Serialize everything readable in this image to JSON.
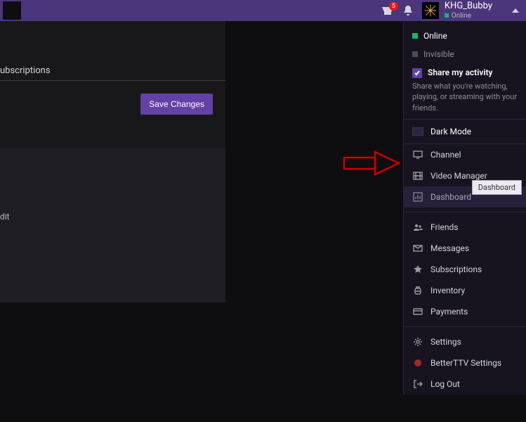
{
  "topbar": {
    "notification_count": "5",
    "username": "KHG_Bubby",
    "status_label": "Online"
  },
  "content": {
    "section_title": "ubscriptions",
    "save_button_label": "Save Changes",
    "partial_text": "dit"
  },
  "dropdown": {
    "status": {
      "online": "Online",
      "invisible": "Invisible"
    },
    "share": {
      "label": "Share my activity",
      "description": "Share what you're watching, playing, or streaming with your friends."
    },
    "dark_mode_label": "Dark Mode",
    "items_group1": [
      {
        "label": "Channel",
        "icon": "monitor-icon"
      },
      {
        "label": "Video Manager",
        "icon": "film-icon"
      },
      {
        "label": "Dashboard",
        "icon": "chart-icon",
        "highlight": true
      }
    ],
    "items_group2": [
      {
        "label": "Friends",
        "icon": "friends-icon"
      },
      {
        "label": "Messages",
        "icon": "mail-icon"
      },
      {
        "label": "Subscriptions",
        "icon": "star-icon"
      },
      {
        "label": "Inventory",
        "icon": "backpack-icon"
      },
      {
        "label": "Payments",
        "icon": "card-icon"
      }
    ],
    "items_group3": [
      {
        "label": "Settings",
        "icon": "gear-icon"
      },
      {
        "label": "BetterTTV Settings",
        "icon": "bttv-icon"
      },
      {
        "label": "Log Out",
        "icon": "logout-icon"
      }
    ]
  },
  "tooltip": {
    "text": "Dashboard"
  }
}
